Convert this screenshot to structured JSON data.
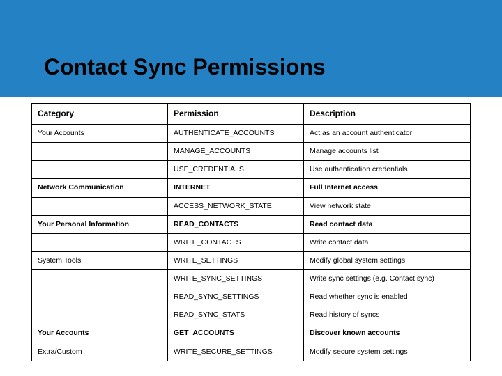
{
  "title": "Contact Sync Permissions",
  "headers": {
    "category": "Category",
    "permission": "Permission",
    "description": "Description"
  },
  "rows": [
    {
      "category": "Your Accounts",
      "cat_bold": false,
      "permission": "AUTHENTICATE_ACCOUNTS",
      "description": "Act as an account authenticator",
      "row_bold": false
    },
    {
      "category": "",
      "cat_bold": false,
      "permission": "MANAGE_ACCOUNTS",
      "description": "Manage accounts list",
      "row_bold": false
    },
    {
      "category": "",
      "cat_bold": false,
      "permission": "USE_CREDENTIALS",
      "description": "Use authentication credentials",
      "row_bold": false
    },
    {
      "category": "Network Communication",
      "cat_bold": true,
      "permission": "INTERNET",
      "description": "Full Internet access",
      "row_bold": true
    },
    {
      "category": "",
      "cat_bold": false,
      "permission": "ACCESS_NETWORK_STATE",
      "description": "View network state",
      "row_bold": false
    },
    {
      "category": "Your Personal Information",
      "cat_bold": true,
      "permission": "READ_CONTACTS",
      "description": "Read contact data",
      "row_bold": true
    },
    {
      "category": "",
      "cat_bold": false,
      "permission": "WRITE_CONTACTS",
      "description": "Write contact data",
      "row_bold": false
    },
    {
      "category": "System Tools",
      "cat_bold": false,
      "permission": "WRITE_SETTINGS",
      "description": "Modify global system settings",
      "row_bold": false
    },
    {
      "category": "",
      "cat_bold": false,
      "permission": "WRITE_SYNC_SETTINGS",
      "description": "Write sync settings (e.g. Contact sync)",
      "row_bold": false
    },
    {
      "category": "",
      "cat_bold": false,
      "permission": "READ_SYNC_SETTINGS",
      "description": "Read whether sync is enabled",
      "row_bold": false
    },
    {
      "category": "",
      "cat_bold": false,
      "permission": "READ_SYNC_STATS",
      "description": "Read history of syncs",
      "row_bold": false
    },
    {
      "category": "Your Accounts",
      "cat_bold": true,
      "permission": "GET_ACCOUNTS",
      "description": "Discover known accounts",
      "row_bold": true
    },
    {
      "category": "Extra/Custom",
      "cat_bold": false,
      "permission": "WRITE_SECURE_SETTINGS",
      "description": "Modify secure system settings",
      "row_bold": false
    }
  ]
}
